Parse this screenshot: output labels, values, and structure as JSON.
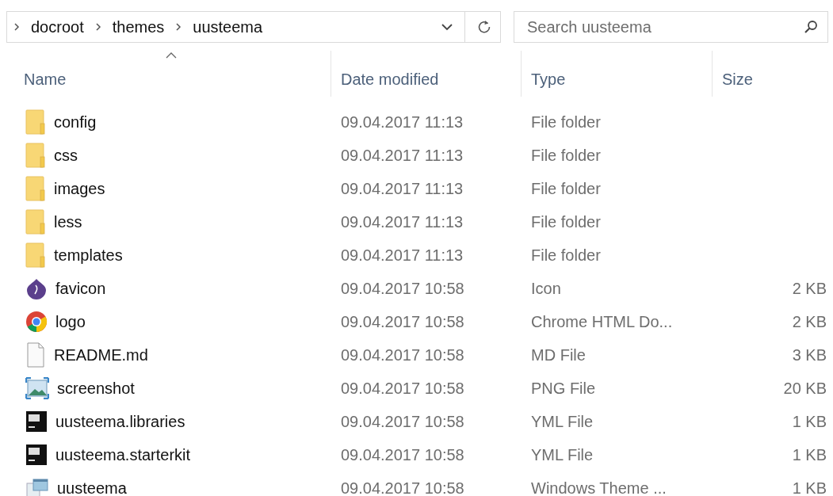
{
  "address_bar": {
    "path": [
      "docroot",
      "themes",
      "uusteema"
    ]
  },
  "search": {
    "placeholder": "Search uusteema"
  },
  "columns": [
    {
      "label": "Name",
      "sorted": true
    },
    {
      "label": "Date modified",
      "sorted": false
    },
    {
      "label": "Type",
      "sorted": false
    },
    {
      "label": "Size",
      "sorted": false
    }
  ],
  "rows": [
    {
      "kind": "folder",
      "name": "config",
      "date": "09.04.2017 11:13",
      "type": "File folder"
    },
    {
      "kind": "folder",
      "name": "css",
      "date": "09.04.2017 11:13",
      "type": "File folder"
    },
    {
      "kind": "folder",
      "name": "images",
      "date": "09.04.2017 11:13",
      "type": "File folder"
    },
    {
      "kind": "folder",
      "name": "less",
      "date": "09.04.2017 11:13",
      "type": "File folder"
    },
    {
      "kind": "folder",
      "name": "templates",
      "date": "09.04.2017 11:13",
      "type": "File folder"
    },
    {
      "kind": "icon",
      "name": "favicon",
      "date": "09.04.2017 10:58",
      "type": "Icon",
      "size": "2 KB"
    },
    {
      "kind": "chrome",
      "name": "logo",
      "date": "09.04.2017 10:58",
      "type": "Chrome HTML Do...",
      "size": "2 KB"
    },
    {
      "kind": "file",
      "name": "README.md",
      "date": "09.04.2017 10:58",
      "type": "MD File",
      "size": "3 KB"
    },
    {
      "kind": "image",
      "name": "screenshot",
      "date": "09.04.2017 10:58",
      "type": "PNG File",
      "size": "20 KB"
    },
    {
      "kind": "ps",
      "name": "uusteema.libraries",
      "date": "09.04.2017 10:58",
      "type": "YML File",
      "size": "1 KB"
    },
    {
      "kind": "ps",
      "name": "uusteema.starterkit",
      "date": "09.04.2017 10:58",
      "type": "YML File",
      "size": "1 KB"
    },
    {
      "kind": "theme",
      "name": "uusteema",
      "date": "09.04.2017 10:58",
      "type": "Windows Theme ...",
      "size": "1 KB"
    }
  ]
}
